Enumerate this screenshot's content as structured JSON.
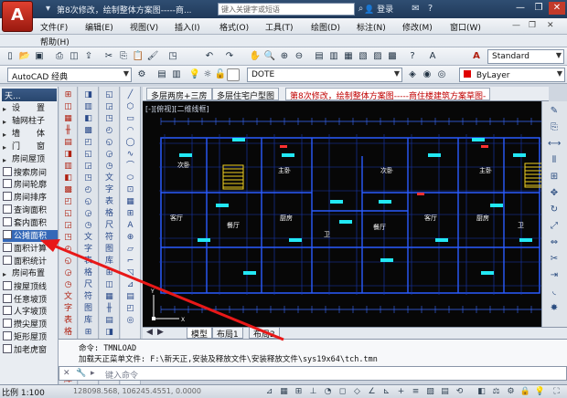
{
  "title_bar": {
    "app_button": "A",
    "document_title": "第8次修改，绘制整体方案图-----商...",
    "search_placeholder": "键入关键字或短语",
    "login_label": "登录",
    "minimize": "—",
    "restore": "❐",
    "close": "✕"
  },
  "menus": [
    "文件(F)",
    "编辑(E)",
    "视图(V)",
    "插入(I)",
    "格式(O)",
    "工具(T)",
    "绘图(D)",
    "标注(N)",
    "修改(M)",
    "窗口(W)"
  ],
  "menu_row2": [
    "帮助(H)"
  ],
  "toolbar1": {
    "style_dropdown": "Standard"
  },
  "toolbar2": {
    "workspace_dropdown": "AutoCAD 经典",
    "layer_dropdown": "DOTE",
    "color_dropdown": "ByLayer"
  },
  "left_panel": {
    "header": "天...",
    "items": [
      {
        "label": "设　　置",
        "group": true
      },
      {
        "label": "轴网柱子",
        "group": true
      },
      {
        "label": "墙　　体",
        "group": true
      },
      {
        "label": "门　　窗",
        "group": true
      },
      {
        "label": "房间屋顶",
        "group": true
      },
      {
        "label": "搜索房间"
      },
      {
        "label": "房间轮廓"
      },
      {
        "label": "房间排序"
      },
      {
        "label": "查询面积"
      },
      {
        "label": "套内面积"
      },
      {
        "label": "公摊面积"
      },
      {
        "label": "面积计算"
      },
      {
        "label": "面积统计"
      },
      {
        "label": "房间布置",
        "group": true
      },
      {
        "label": "搜屋顶线"
      },
      {
        "label": "任意坡顶"
      },
      {
        "label": "人字坡顶"
      },
      {
        "label": "攒尖屋顶"
      },
      {
        "label": "矩形屋顶"
      },
      {
        "label": "加老虎窗"
      }
    ]
  },
  "vertical_toolbar_a": [
    "⊞",
    "◫",
    "▦",
    "╫",
    "▤",
    "◨",
    "▥",
    "◧",
    "▩",
    "◰",
    "◱",
    "◲",
    "◳",
    "◴",
    "◵",
    "◶",
    "◷",
    "文",
    "字",
    "表",
    "格",
    "尺",
    "符",
    "图",
    "库"
  ],
  "doc_tabs": [
    {
      "label": "多层两房+三房",
      "active": false
    },
    {
      "label": "多层住宅户型图",
      "active": false
    },
    {
      "label": "第8次修改，绘制整体方案图-----商住楼建筑方案草图-",
      "active": true
    }
  ],
  "view_label": "[-][俯视][二维线框]",
  "room_labels": [
    {
      "text": "次卧"
    },
    {
      "text": "主卧"
    },
    {
      "text": "客厅"
    },
    {
      "text": "餐厅"
    },
    {
      "text": "厨房"
    },
    {
      "text": "卫"
    },
    {
      "text": "次卧"
    },
    {
      "text": "主卧"
    },
    {
      "text": "客厅"
    },
    {
      "text": "餐厅"
    },
    {
      "text": "厨房"
    },
    {
      "text": "卫"
    }
  ],
  "layout_tabs": [
    {
      "label": "模型",
      "active": true
    },
    {
      "label": "布局1",
      "active": false
    },
    {
      "label": "布局2",
      "active": false
    }
  ],
  "command_history": [
    "命令: TMNLOAD",
    "加载天正菜单文件: F:\\新天正,安装及释放文件\\安装释放文件\\sys19x64\\tch.tmn"
  ],
  "command_prompt": "键入命令",
  "status_bar": {
    "scale": "比例 1:100",
    "coordinates": "128098.568, 106245.4551, 0.0000"
  },
  "colors": {
    "accent_red": "#e03020",
    "canvas_bg": "#070707",
    "wall_blue": "#2a5cff",
    "highlight_cyan": "#22e8f4",
    "stair_yellow": "#f0d020"
  }
}
